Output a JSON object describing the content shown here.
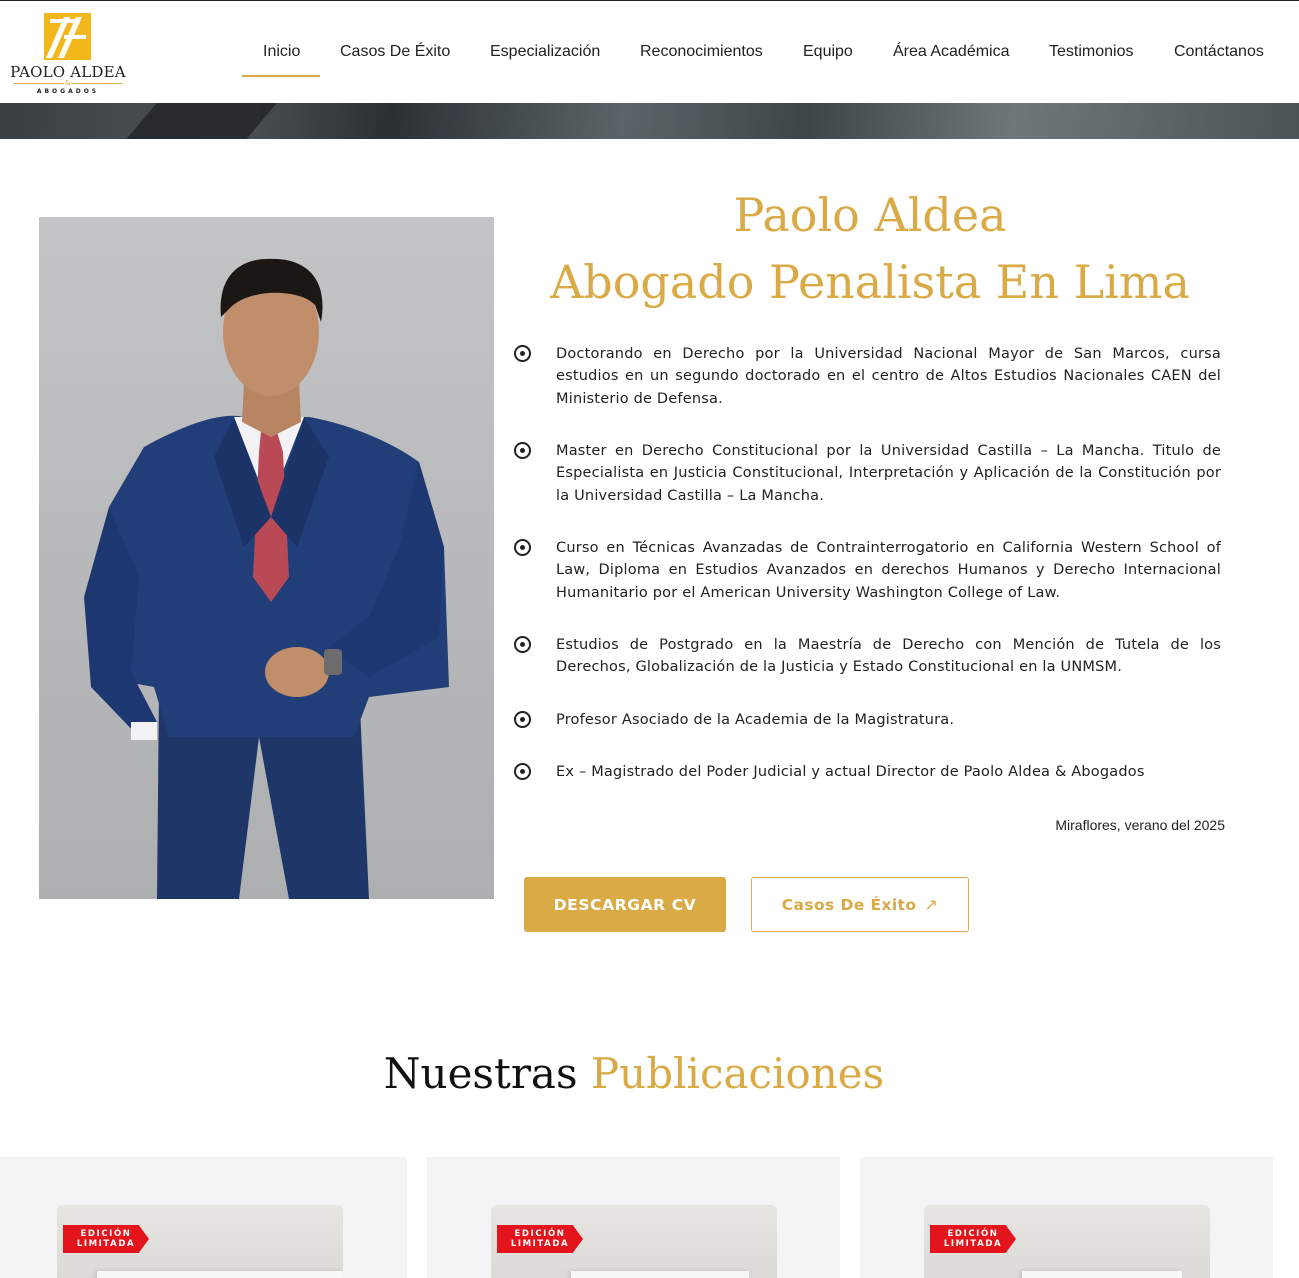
{
  "brand": {
    "name": "PAOLO ALDEA",
    "ampersand": "&",
    "sub": "ABOGADOS",
    "accent_color": "#d9aa45"
  },
  "nav": {
    "active": "Inicio",
    "items": [
      "Inicio",
      "Casos De Éxito",
      "Especialización",
      "Reconocimientos",
      "Equipo",
      "Área Académica",
      "Testimonios",
      "Contáctanos"
    ]
  },
  "hero": {
    "title_line1": "Paolo Aldea",
    "title_line2": "Abogado Penalista En Lima",
    "bullets": [
      "Doctorando en Derecho por la Universidad Nacional Mayor de San Marcos, cursa estudios en un segundo doctorado en el centro de Altos Estudios Nacionales CAEN del Ministerio de Defensa.",
      "Master en Derecho Constitucional por la Universidad Castilla – La Mancha. Titulo de Especialista en Justicia Constitucional, Interpretación y Aplicación de la Constitución por la Universidad Castilla – La Mancha.",
      "Curso en Técnicas Avanzadas de Contrainterrogatorio en California Western School of Law, Diploma en Estudios Avanzados en derechos Humanos y Derecho Internacional Humanitario por el American University Washington College of Law.",
      "Estudios de Postgrado en la Maestría de Derecho con Mención de Tutela de los Derechos, Globalización de la Justicia y Estado Constitucional en la UNMSM.",
      "Profesor Asociado de la Academia de la Magistratura.",
      "Ex – Magistrado del Poder Judicial y actual Director de Paolo Aldea & Abogados"
    ],
    "signature": "Miraflores, verano del 2025",
    "btn_cv": "DESCARGAR CV",
    "btn_casos": "Casos De Éxito",
    "btn_casos_icon": "arrow-up-right-icon"
  },
  "publicaciones": {
    "title_dark": "Nuestras",
    "title_gold": "Publicaciones",
    "ribbon_line1": "EDICIÓN",
    "ribbon_line2": "LIMITADA"
  }
}
